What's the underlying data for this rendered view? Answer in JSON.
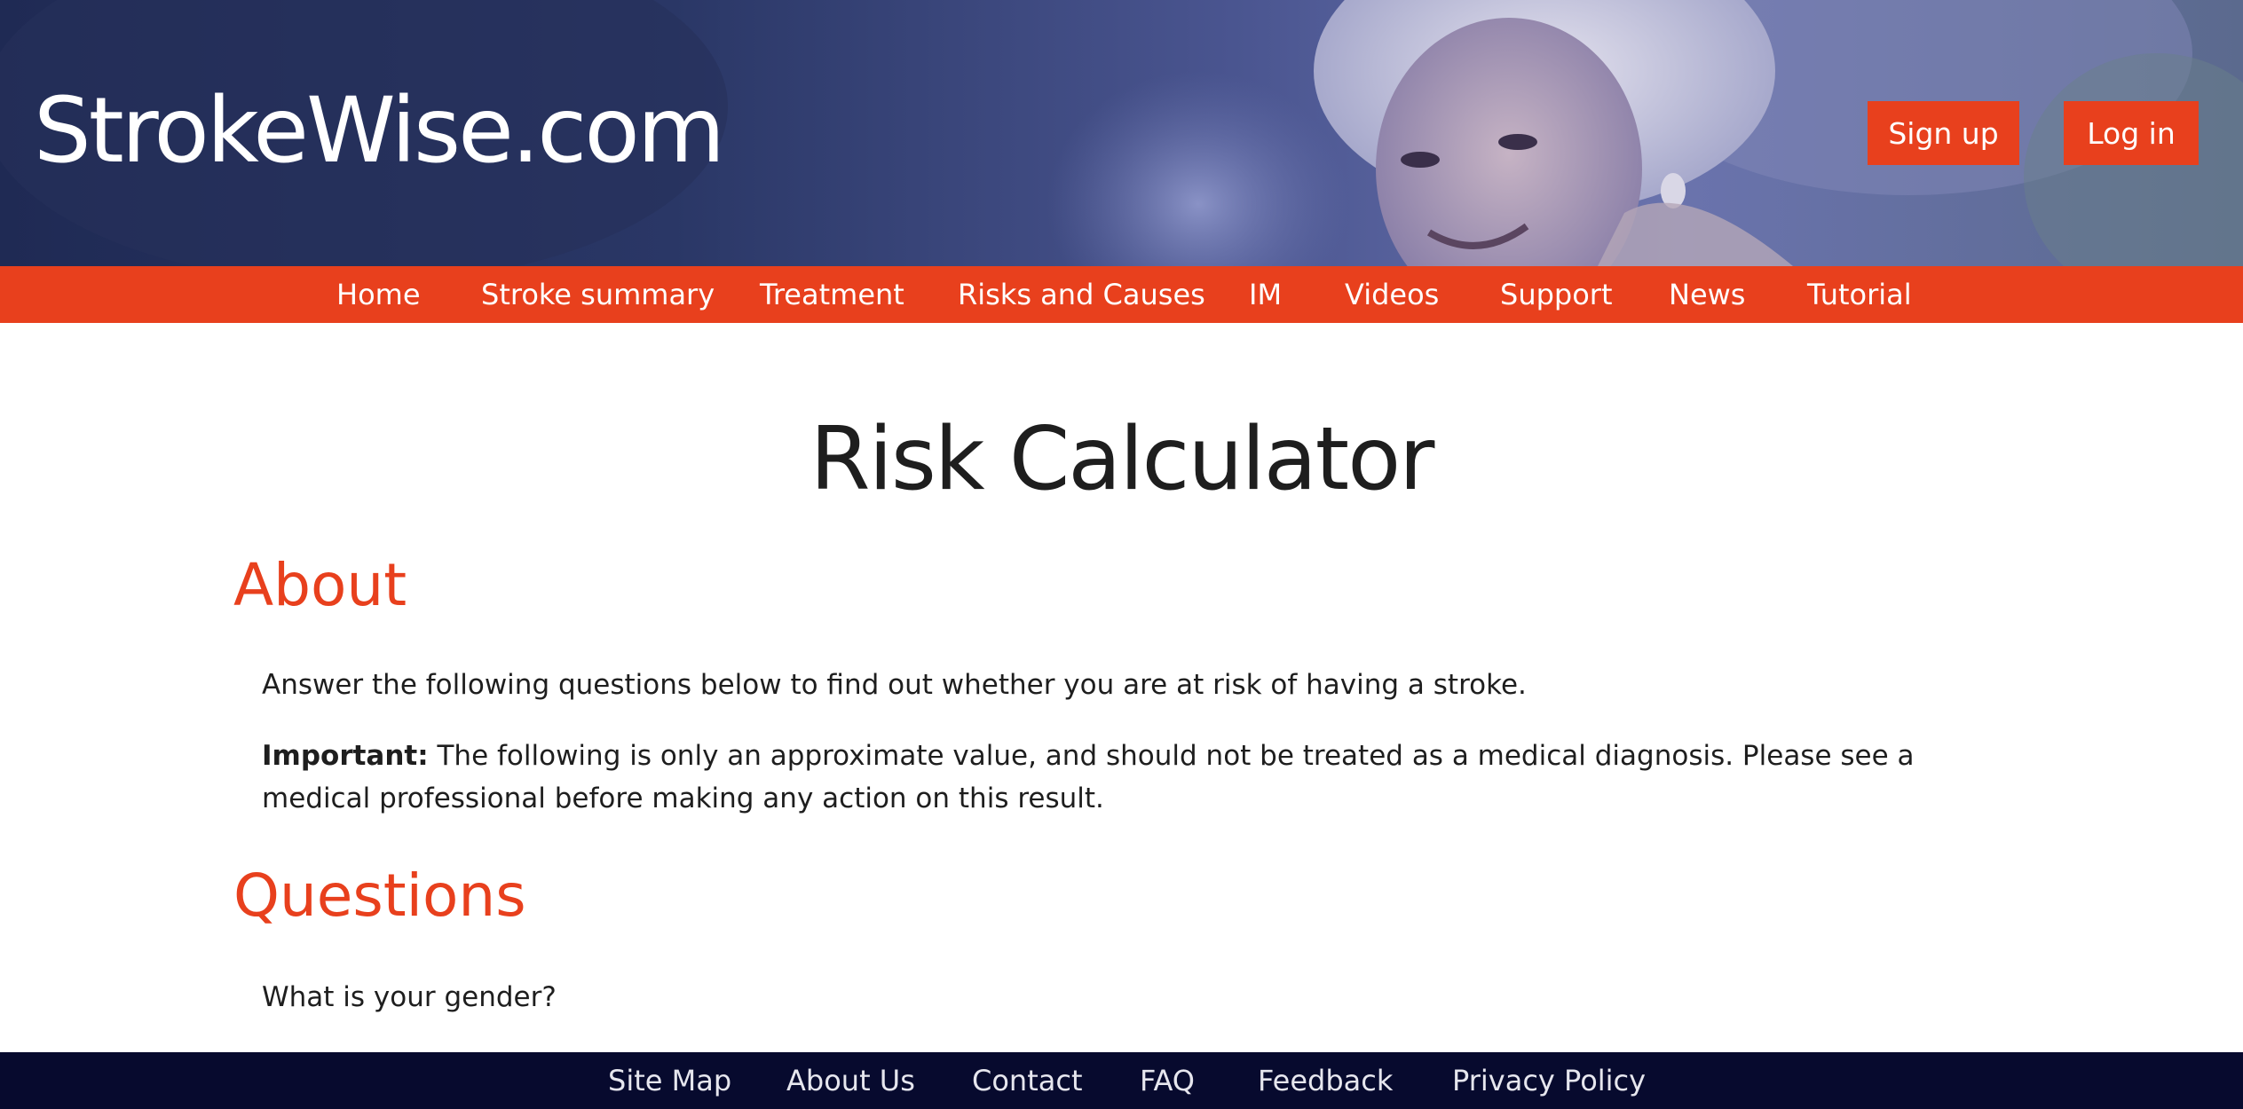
{
  "site": {
    "brand": "StrokeWise.com",
    "accent_color": "#e8401d",
    "footer_color": "#070a2e"
  },
  "header": {
    "hero_image": "smiling-elderly-woman-photo",
    "auth": {
      "signup_label": "Sign up",
      "login_label": "Log in"
    }
  },
  "nav": {
    "items": [
      {
        "label": "Home"
      },
      {
        "label": "Stroke summary"
      },
      {
        "label": "Treatment"
      },
      {
        "label": "Risks and Causes"
      },
      {
        "label": "IM"
      },
      {
        "label": "Videos"
      },
      {
        "label": "Support"
      },
      {
        "label": "News"
      },
      {
        "label": "Tutorial"
      }
    ]
  },
  "main": {
    "title": "Risk Calculator",
    "about": {
      "heading": "About",
      "intro": "Answer the following questions below to find out whether you are at risk of having a stroke.",
      "important_label": "Important:",
      "important_text": " The following is only an approximate value, and should not be treated as a medical diagnosis. Please see a medical professional before making any action on this result."
    },
    "questions": {
      "heading": "Questions",
      "items": [
        {
          "label": "What is your gender?"
        }
      ]
    }
  },
  "footer": {
    "items": [
      {
        "label": "Site Map"
      },
      {
        "label": "About Us"
      },
      {
        "label": "Contact"
      },
      {
        "label": "FAQ"
      },
      {
        "label": "Feedback"
      },
      {
        "label": "Privacy Policy"
      }
    ]
  }
}
